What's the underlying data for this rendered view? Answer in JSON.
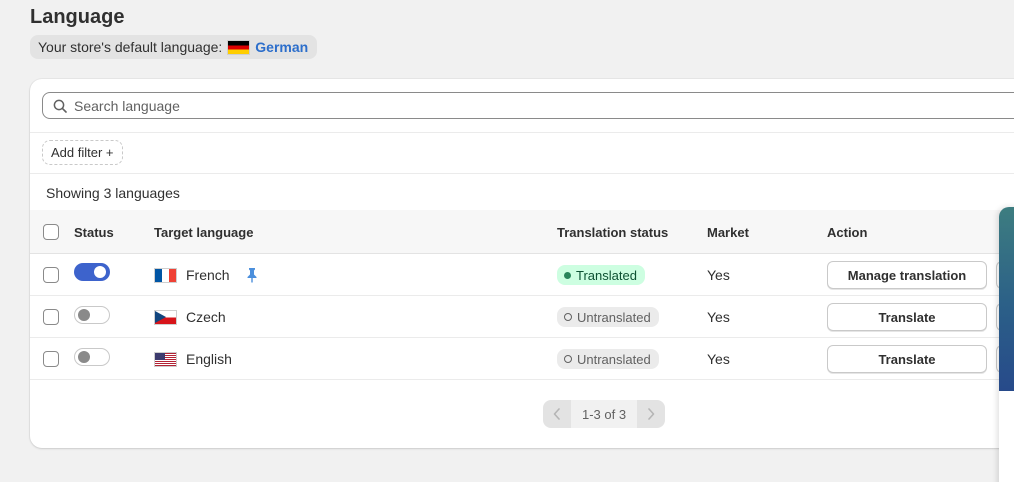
{
  "page": {
    "title": "Language",
    "default_language_label": "Your store's default language:",
    "default_language_name": "German",
    "default_language_flag": "flag-de"
  },
  "search": {
    "placeholder": "Search language",
    "value": ""
  },
  "filters": {
    "add_filter_label": "Add filter +"
  },
  "summary": {
    "showing_text": "Showing 3 languages"
  },
  "table": {
    "columns": {
      "status": "Status",
      "target_language": "Target language",
      "translation_status": "Translation status",
      "market": "Market",
      "action": "Action"
    },
    "rows": [
      {
        "enabled": true,
        "flag": "flag-fr",
        "language": "French",
        "pinned": true,
        "translation_status": "Translated",
        "market": "Yes",
        "action": "Manage translation"
      },
      {
        "enabled": false,
        "flag": "flag-cz",
        "language": "Czech",
        "pinned": false,
        "translation_status": "Untranslated",
        "market": "Yes",
        "action": "Translate"
      },
      {
        "enabled": false,
        "flag": "flag-us",
        "language": "English",
        "pinned": false,
        "translation_status": "Untranslated",
        "market": "Yes",
        "action": "Translate"
      }
    ]
  },
  "pagination": {
    "range_text": "1-3 of 3"
  },
  "colors": {
    "accent": "#3d63cc",
    "link": "#2c6ecb",
    "translated_bg": "#cdfee1",
    "untranslated_bg": "#ebebeb",
    "pin": "#4b8fdc"
  },
  "icons": {
    "search": "search-icon",
    "pin": "pin-icon",
    "prev": "chevron-left-icon",
    "next": "chevron-right-icon"
  }
}
